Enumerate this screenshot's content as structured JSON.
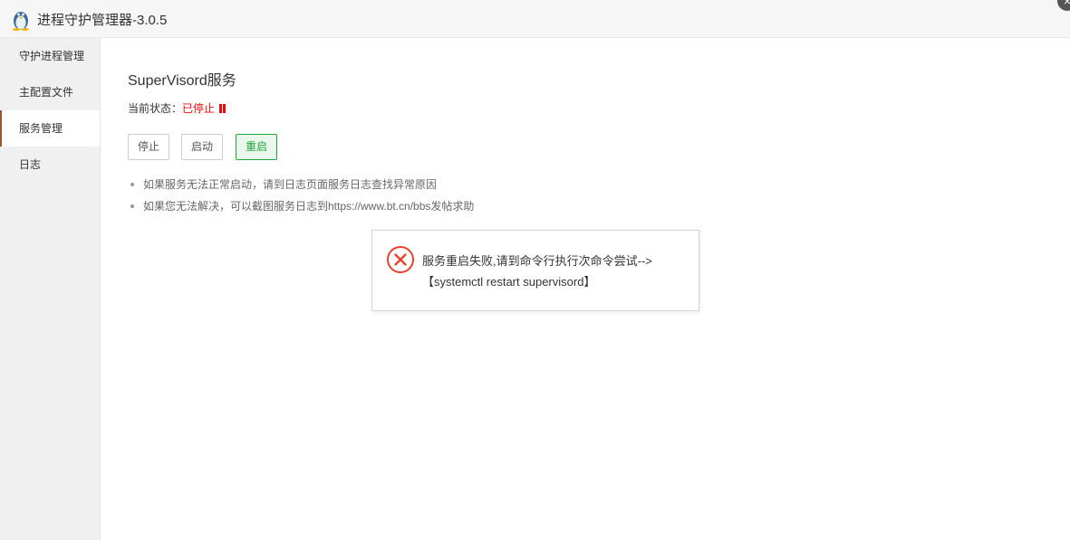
{
  "window": {
    "title": "进程守护管理器-3.0.5",
    "close_glyph": "×"
  },
  "sidebar": {
    "items": [
      {
        "label": "守护进程管理"
      },
      {
        "label": "主配置文件"
      },
      {
        "label": "服务管理"
      },
      {
        "label": "日志"
      }
    ],
    "active_index": 2
  },
  "main": {
    "heading": "SuperVisord服务",
    "status_label": "当前状态：",
    "status_value": "已停止",
    "status_color": "#ef0808",
    "buttons": {
      "stop": "停止",
      "start": "启动",
      "restart": "重启"
    },
    "tips": [
      "如果服务无法正常启动，请到日志页面服务日志查找异常原因",
      "如果您无法解决，可以截图服务日志到https://www.bt.cn/bbs发帖求助"
    ]
  },
  "dialog": {
    "message_line1": "服务重启失败,请到命令行执行次命令尝试-->",
    "message_line2": "【systemctl restart supervisord】",
    "icon": "error-circle-x-icon",
    "accent_color": "#e8412f"
  },
  "colors": {
    "accent_green": "#20a53a",
    "sidebar_active_border": "#a0522d"
  }
}
